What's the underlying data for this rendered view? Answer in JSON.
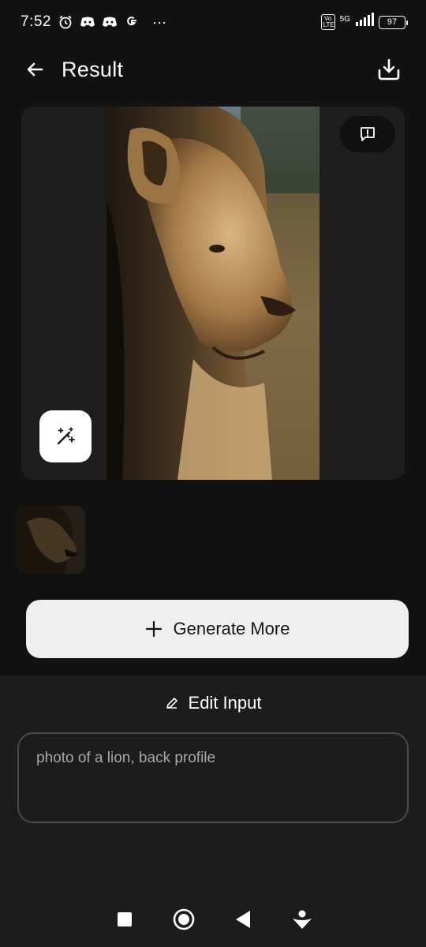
{
  "status_bar": {
    "time": "7:52",
    "network": "5G",
    "volte": "Vo LTE",
    "battery": "97",
    "overflow": "···",
    "icons": [
      "alarm-icon",
      "discord-icon",
      "discord-icon",
      "google-icon"
    ]
  },
  "header": {
    "title": "Result",
    "back_icon": "arrow-left-icon",
    "download_icon": "download-icon"
  },
  "result": {
    "image_subject": "lion-side-profile",
    "report_icon": "report-icon",
    "magic_icon": "magic-wand-icon"
  },
  "thumbnails": [
    {
      "subject": "lion-side-profile",
      "selected": true
    }
  ],
  "actions": {
    "generate_more_label": "Generate More",
    "generate_icon": "plus-icon"
  },
  "edit": {
    "heading": "Edit Input",
    "heading_icon": "pencil-icon",
    "prompt_text": "photo of a lion, back profile"
  },
  "navbar": {
    "items": [
      "recents-icon",
      "home-icon",
      "back-icon",
      "assistant-icon"
    ]
  },
  "colors": {
    "background": "#121212",
    "card": "#1e1e1e",
    "panel": "#1c1c1c",
    "button": "#efefef"
  }
}
